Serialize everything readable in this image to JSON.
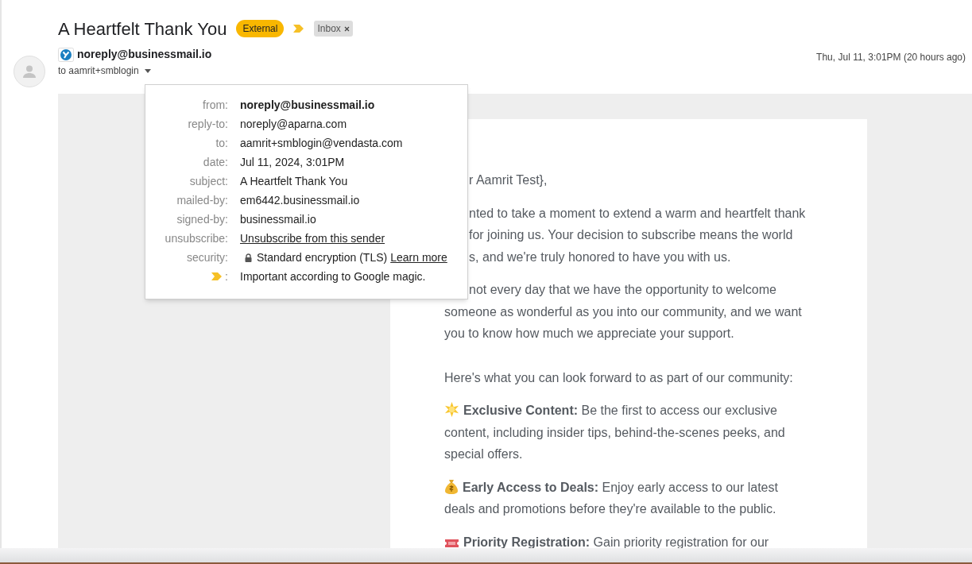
{
  "subject": "A Heartfelt Thank You",
  "labels": [
    {
      "text": "External",
      "kind": "warning"
    },
    {
      "text": "Inbox",
      "kind": "folder",
      "removable": true
    }
  ],
  "important": true,
  "sender": {
    "address": "noreply@businessmail.io",
    "recipient": "to aamrit+smblogin",
    "time": "Thu, Jul 11, 3:01PM (20 hours ago)"
  },
  "details_popup": {
    "rows": [
      {
        "label": "from:",
        "value": "noreply@businessmail.io",
        "kind": "bold"
      },
      {
        "label": "reply-to:",
        "value": "noreply@aparna.com",
        "kind": "plain"
      },
      {
        "label": "to:",
        "value": "aamrit+smblogin@vendasta.com",
        "kind": "plain"
      },
      {
        "label": "date:",
        "value": "Jul 11, 2024, 3:01PM",
        "kind": "plain"
      },
      {
        "label": "subject:",
        "value": "A Heartfelt Thank You",
        "kind": "plain"
      },
      {
        "label": "mailed-by:",
        "value": "em6442.businessmail.io",
        "kind": "plain"
      },
      {
        "label": "signed-by:",
        "value": "businessmail.io",
        "kind": "plain"
      },
      {
        "label": "unsubscribe:",
        "value": "Unsubscribe from this sender",
        "kind": "link"
      },
      {
        "label": "security:",
        "value": "Standard encryption (TLS)",
        "link": "Learn more",
        "kind": "security"
      },
      {
        "label": ":",
        "value": "Important according to Google magic.",
        "kind": "importance"
      }
    ]
  },
  "body": [
    {
      "kind": "text",
      "lines": [
        "r Aamrit Test},"
      ]
    },
    {
      "kind": "text",
      "lines": [
        "nted to take a moment to extend a warm and heartfelt thank",
        "for joining us. Your decision to subscribe means the world",
        "s, and we're truly honored to have you with us."
      ]
    },
    {
      "kind": "text",
      "lines": [
        "not every day that we have the opportunity to welcome",
        "someone as wonderful as you into our community, and we want",
        "you to know how much we appreciate your support."
      ]
    },
    {
      "kind": "lead",
      "lines": [
        "Here's what you can look forward to as part of our community:"
      ]
    },
    {
      "kind": "feature",
      "lines": [
        "**Exclusive Content:** Be the first to access our exclusive",
        "content, including insider tips, behind-the-scenes peeks, and",
        "special offers."
      ]
    },
    {
      "kind": "feature",
      "lines": [
        "**Early Access to Deals:** Enjoy early access to our latest",
        "deals and promotions before they're available to the public."
      ]
    },
    {
      "kind": "feature",
      "lines": [
        "**Priority Registration:** Gain priority registration for our"
      ]
    }
  ]
}
